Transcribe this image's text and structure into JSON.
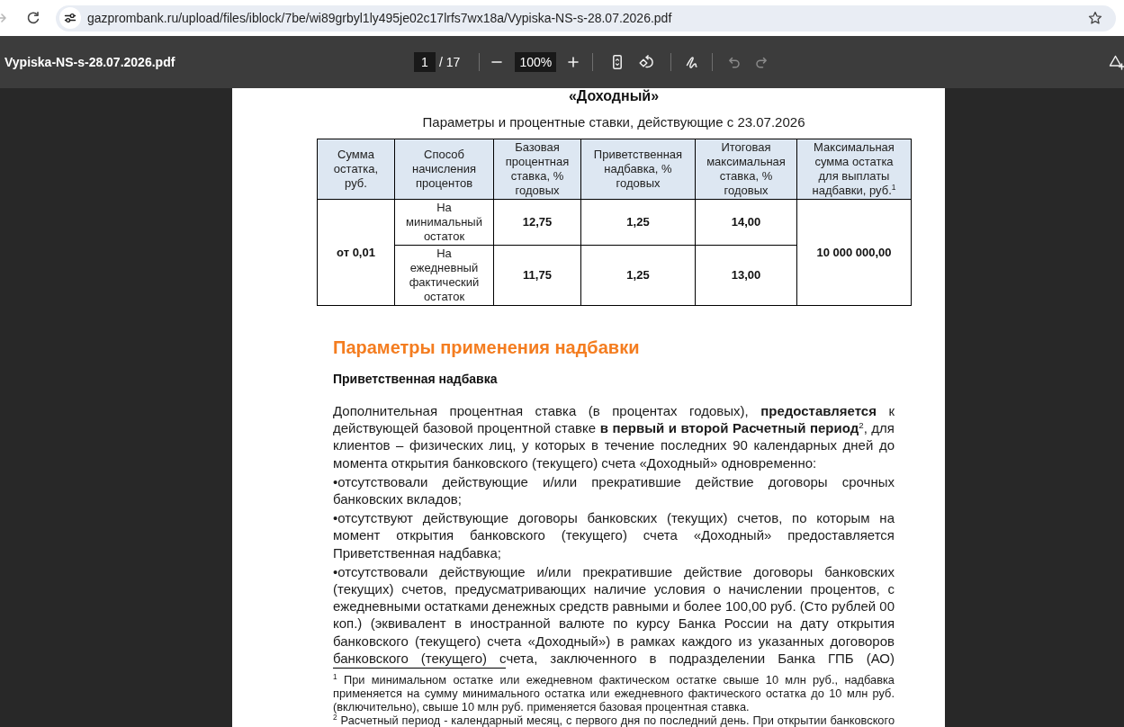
{
  "browser": {
    "forward_disabled": true,
    "url": "gazprombank.ru/upload/files/iblock/7be/wi89grbyl1ly495je02c17lrfs7wx18a/Vypiska-NS-s-28.07.2026.pdf"
  },
  "viewer": {
    "file_name": "Vypiska-NS-s-28.07.2026.pdf",
    "page": "1",
    "page_count": "/ 17",
    "zoom": "100%",
    "undo_disabled": true,
    "redo_disabled": true
  },
  "document": {
    "title": "«Доходный»",
    "subtitle": "Параметры и процентные ставки, действующие с 23.07.2026",
    "table": {
      "columns": [
        "Сумма остатка, руб.",
        "Способ начисления процентов",
        "Базовая процентная ставка, % годовых",
        "Приветственная надбавка, % годовых",
        "Итоговая максимальная ставка, % годовых",
        "Максимальная сумма остатка для выплаты надбавки, руб.$^{1}$"
      ],
      "amount": "от 0,01",
      "max_amount": "10 000 000,00",
      "rows": [
        {
          "method": "На минимальный остаток",
          "base_rate": "12,75",
          "bonus": "1,25",
          "total": "14,00"
        },
        {
          "method": "На ежедневный фактический остаток",
          "base_rate": "11,75",
          "bonus": "1,25",
          "total": "13,00"
        }
      ]
    },
    "section_heading": "Параметры применения надбавки",
    "subsection_heading": "Приветственная надбавка",
    "paragraph": "Дополнительная процентная ставка (в процентах годовых), **предоставляется** к действующей базовой процентной ставке **в первый и второй Расчетный период**$^{2}$, для клиентов – физических лиц, у которых в течение последних 90 календарных дней до момента открытия банковского (текущего) счета «Доходный» одновременно:",
    "list_items": [
      {
        "text": "•отсутствовали действующие и/или прекратившие действие договоры срочных банковских вкладов;",
        "continues": false
      },
      {
        "text": "•отсутствуют действующие договоры банковских (текущих) счетов, по которым на момент открытия банковского (текущего) счета «Доходный» предоставляется Приветственная надбавка;",
        "continues": false
      },
      {
        "text": "•отсутствовали действующие и/или прекратившие действие договоры банковских (текущих) счетов, предусматривающих наличие условия о начислении процентов, с ежедневными остатками денежных средств равными и более 100,00 руб. (Сто рублей 00 коп.) (эквивалент в иностранной валюте по курсу Банка России на дату открытия банковского (текущего) счета «Доходный») в рамках каждого из указанных договоров банковского (текущего) счета, заключенного в подразделении Банка ГПБ (АО)",
        "continues": true
      }
    ],
    "footnotes": [
      {
        "text": "$^{1}$ При минимальном остатке или ежедневном фактическом остатке свыше 10 млн руб., надбавка применяется на сумму минимального остатка или ежедневного фактического остатка до 10 млн руб. (включительно), свыше 10 млн руб. применяется базовая процентная ставка.",
        "continues": false
      },
      {
        "text": "$^{2}$ Расчетный период - календарный месяц, с первого дня по последний день. При открытии банковского",
        "continues": true
      }
    ]
  }
}
